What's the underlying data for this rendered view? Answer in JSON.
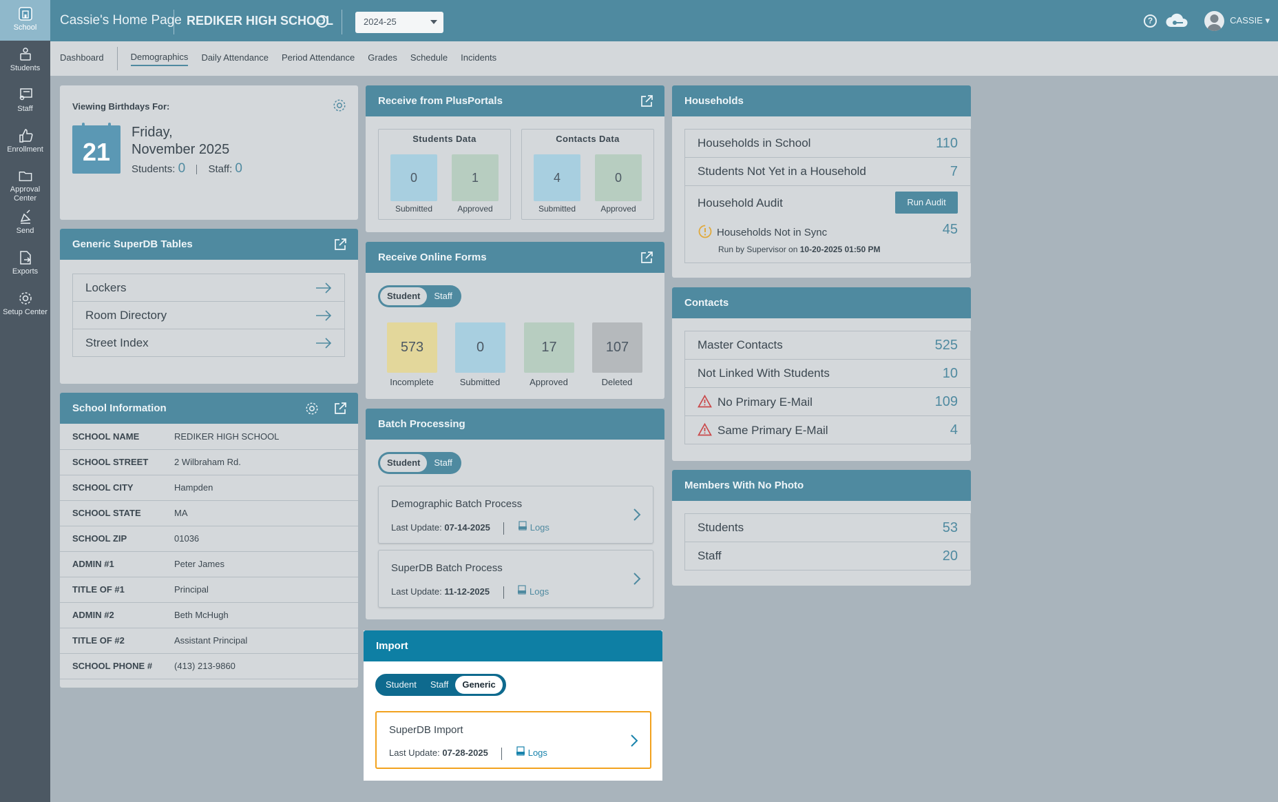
{
  "rail": [
    {
      "label": "School",
      "icon": "school-icon"
    },
    {
      "label": "Students",
      "icon": "students-icon"
    },
    {
      "label": "Staff",
      "icon": "staff-icon"
    },
    {
      "label": "Enrollment",
      "icon": "thumbs-up-icon"
    },
    {
      "label": "Approval Center",
      "icon": "folder-icon"
    },
    {
      "label": "Send",
      "icon": "send-icon"
    },
    {
      "label": "Exports",
      "icon": "export-icon"
    },
    {
      "label": "Setup Center",
      "icon": "gear-icon"
    }
  ],
  "header": {
    "home": "Cassie's Home Page",
    "school": "REDIKER HIGH SCHOOL",
    "year": "2024-25",
    "user": "CASSIE"
  },
  "tabs": [
    "Dashboard",
    "Demographics",
    "Daily Attendance",
    "Period Attendance",
    "Grades",
    "Schedule",
    "Incidents"
  ],
  "birthdays": {
    "label": "Viewing Birthdays For:",
    "day": "21",
    "weekday": "Friday,",
    "monthyear": "November 2025",
    "students_label": "Students:",
    "students": "0",
    "staff_label": "Staff:",
    "staff": "0"
  },
  "superdb": {
    "title": "Generic SuperDB Tables",
    "items": [
      "Lockers",
      "Room Directory",
      "Street Index"
    ]
  },
  "school_info": {
    "title": "School Information",
    "rows": [
      {
        "k": "SCHOOL NAME",
        "v": "REDIKER HIGH SCHOOL"
      },
      {
        "k": "SCHOOL STREET",
        "v": "2 Wilbraham Rd."
      },
      {
        "k": "SCHOOL CITY",
        "v": "Hampden"
      },
      {
        "k": "SCHOOL STATE",
        "v": "MA"
      },
      {
        "k": "SCHOOL ZIP",
        "v": "01036"
      },
      {
        "k": "ADMIN #1",
        "v": "Peter James"
      },
      {
        "k": "TITLE OF #1",
        "v": "Principal"
      },
      {
        "k": "ADMIN #2",
        "v": "Beth McHugh"
      },
      {
        "k": "TITLE OF #2",
        "v": "Assistant Principal"
      },
      {
        "k": "SCHOOL PHONE #",
        "v": "(413) 213-9860"
      }
    ]
  },
  "plusportals": {
    "title": "Receive from PlusPortals",
    "students_title": "Students Data",
    "contacts_title": "Contacts Data",
    "students_submitted": "0",
    "students_approved": "1",
    "contacts_submitted": "4",
    "contacts_approved": "0",
    "submitted_label": "Submitted",
    "approved_label": "Approved"
  },
  "online_forms": {
    "title": "Receive Online Forms",
    "toggle": [
      "Student",
      "Staff"
    ],
    "incomplete": "573",
    "submitted": "0",
    "approved": "17",
    "deleted": "107",
    "incomplete_label": "Incomplete",
    "submitted_label": "Submitted",
    "approved_label": "Approved",
    "deleted_label": "Deleted"
  },
  "batch": {
    "title": "Batch Processing",
    "toggle": [
      "Student",
      "Staff"
    ],
    "items": [
      {
        "name": "Demographic Batch Process",
        "update_label": "Last Update:",
        "date": "07-14-2025",
        "logs": "Logs"
      },
      {
        "name": "SuperDB Batch Process",
        "update_label": "Last Update:",
        "date": "11-12-2025",
        "logs": "Logs"
      }
    ]
  },
  "import": {
    "title": "Import",
    "toggle": [
      "Student",
      "Staff",
      "Generic"
    ],
    "item": {
      "name": "SuperDB Import",
      "update_label": "Last Update:",
      "date": "07-28-2025",
      "logs": "Logs"
    }
  },
  "households": {
    "title": "Households",
    "in_school_label": "Households in School",
    "in_school": "110",
    "not_in_hh_label": "Students Not Yet in a Household",
    "not_in_hh": "7",
    "audit_label": "Household Audit",
    "run_audit": "Run Audit",
    "not_sync_label": "Households Not in Sync",
    "not_sync": "45",
    "run_by": "Run by Supervisor on",
    "run_date": "10-20-2025 01:50 PM"
  },
  "contacts": {
    "title": "Contacts",
    "rows": [
      {
        "label": "Master Contacts",
        "value": "525"
      },
      {
        "label": "Not Linked With Students",
        "value": "10"
      },
      {
        "label": "No Primary E-Mail",
        "value": "109"
      },
      {
        "label": "Same Primary E-Mail",
        "value": "4"
      }
    ]
  },
  "no_photo": {
    "title": "Members With No Photo",
    "rows": [
      {
        "label": "Students",
        "value": "53"
      },
      {
        "label": "Staff",
        "value": "20"
      }
    ]
  },
  "colors": {
    "accent": "#4f8aa0",
    "import_header": "#0e7fa4",
    "highlight": "#f2a21e",
    "incomplete": "#e3d79b",
    "submitted": "#a8cfe0",
    "approved": "#b7cdc0",
    "deleted": "#b5b9bc"
  }
}
